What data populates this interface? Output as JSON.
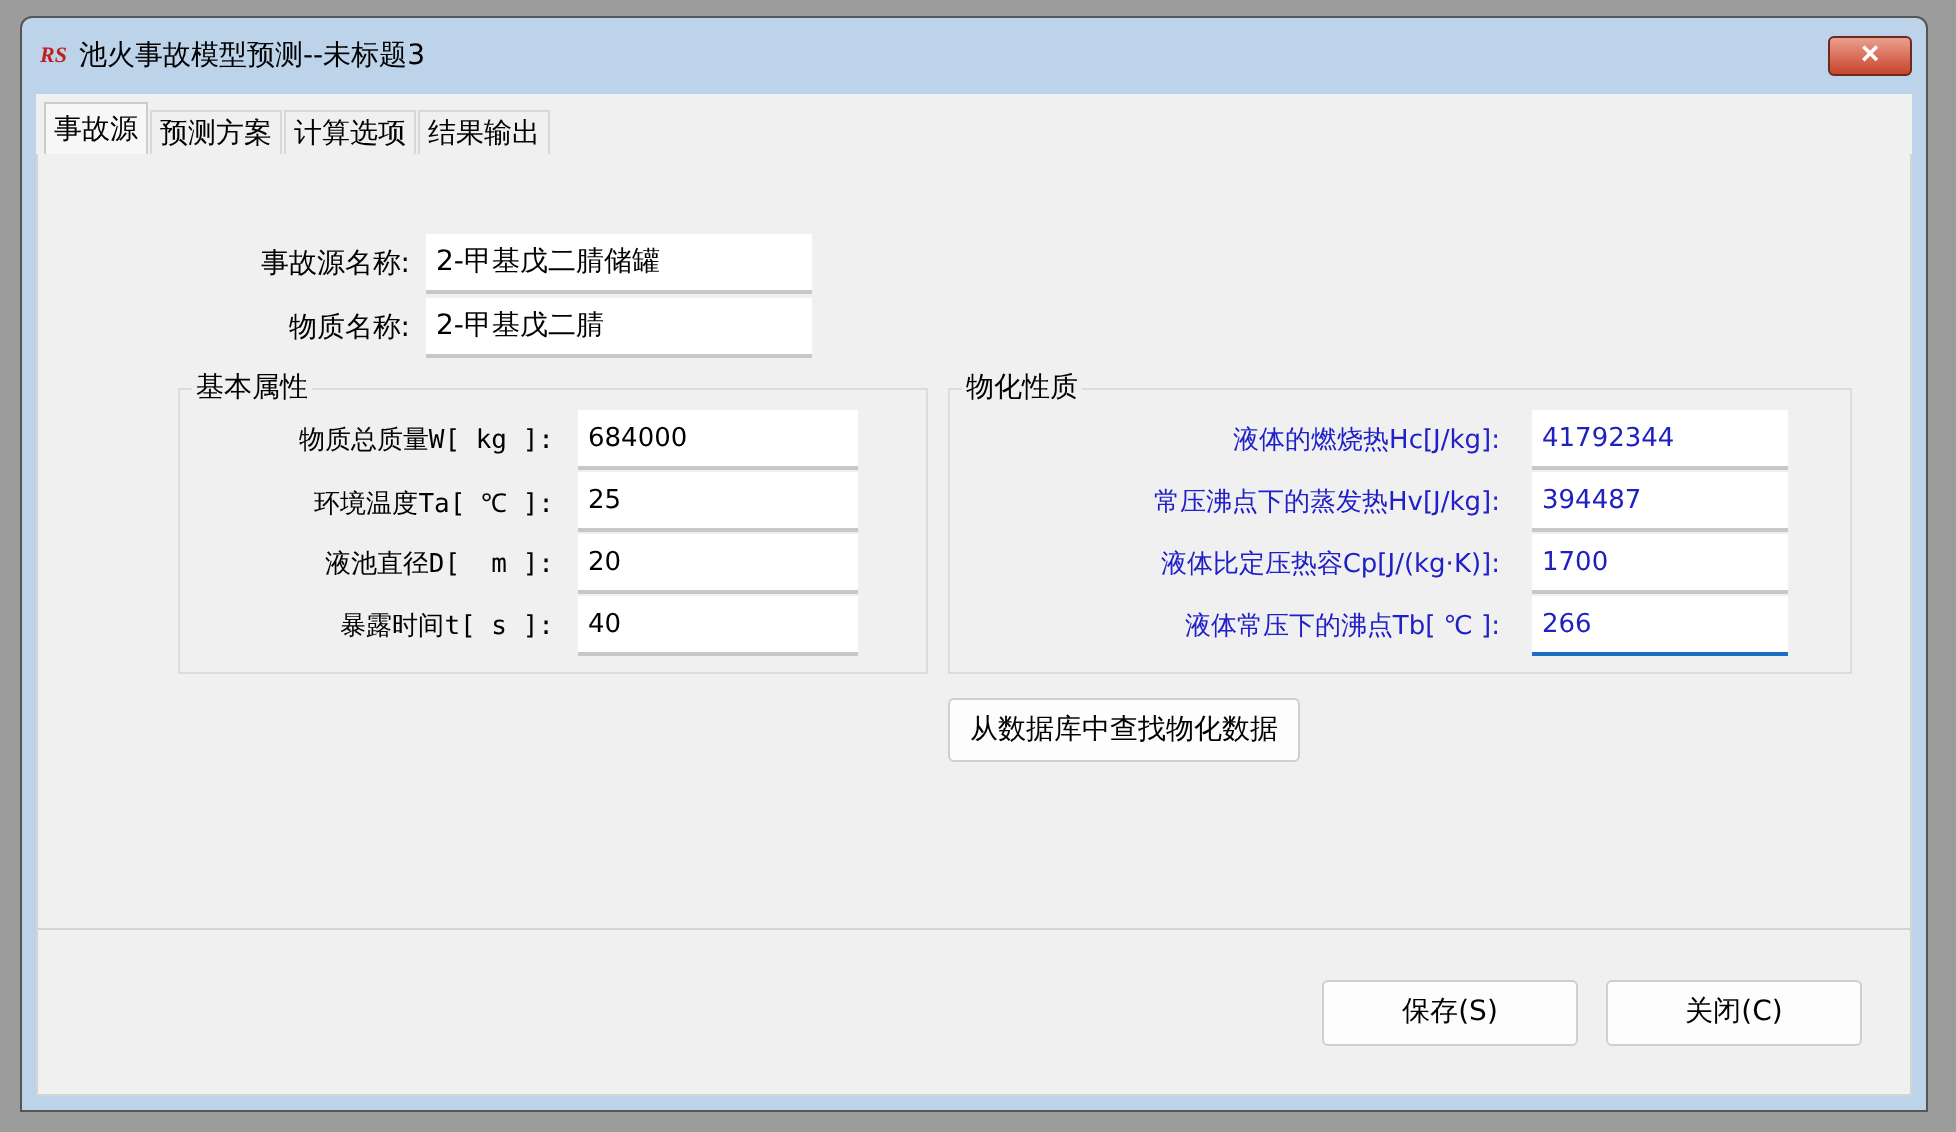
{
  "window": {
    "logo": "RS",
    "title": "池火事故模型预测--未标题3",
    "close": "×"
  },
  "tabs": [
    {
      "label": "事故源",
      "selected": true
    },
    {
      "label": "预测方案",
      "selected": false
    },
    {
      "label": "计算选项",
      "selected": false
    },
    {
      "label": "结果输出",
      "selected": false
    }
  ],
  "source_fields": [
    {
      "label": "事故源名称:",
      "value": "2-甲基戊二腈储罐"
    },
    {
      "label": "物质名称:",
      "value": "2-甲基戊二腈"
    }
  ],
  "basic_properties": {
    "title": "基本属性",
    "fields": [
      {
        "label": "物质总质量W[ kg ]:",
        "value": "684000",
        "focused": false
      },
      {
        "label": "环境温度Ta[ ℃ ]:",
        "value": "25",
        "focused": false
      },
      {
        "label": "液池直径D[  m ]:",
        "value": "20",
        "focused": false
      },
      {
        "label": "暴露时间t[ s ]:",
        "value": "40",
        "focused": false
      }
    ]
  },
  "physical_properties": {
    "title": "物化性质",
    "fields": [
      {
        "label": "液体的燃烧热Hc[J/kg]:",
        "value": "41792344",
        "focused": false
      },
      {
        "label": "常压沸点下的蒸发热Hv[J/kg]:",
        "value": "394487",
        "focused": false
      },
      {
        "label": "液体比定压热容Cp[J/(kg·K)]:",
        "value": "1700",
        "focused": false
      },
      {
        "label": "液体常压下的沸点Tb[ ℃ ]:",
        "value": "266",
        "focused": true
      }
    ]
  },
  "lookup_button": "从数据库中查找物化数据",
  "buttons": [
    "保存(S)",
    "关闭(C)"
  ]
}
